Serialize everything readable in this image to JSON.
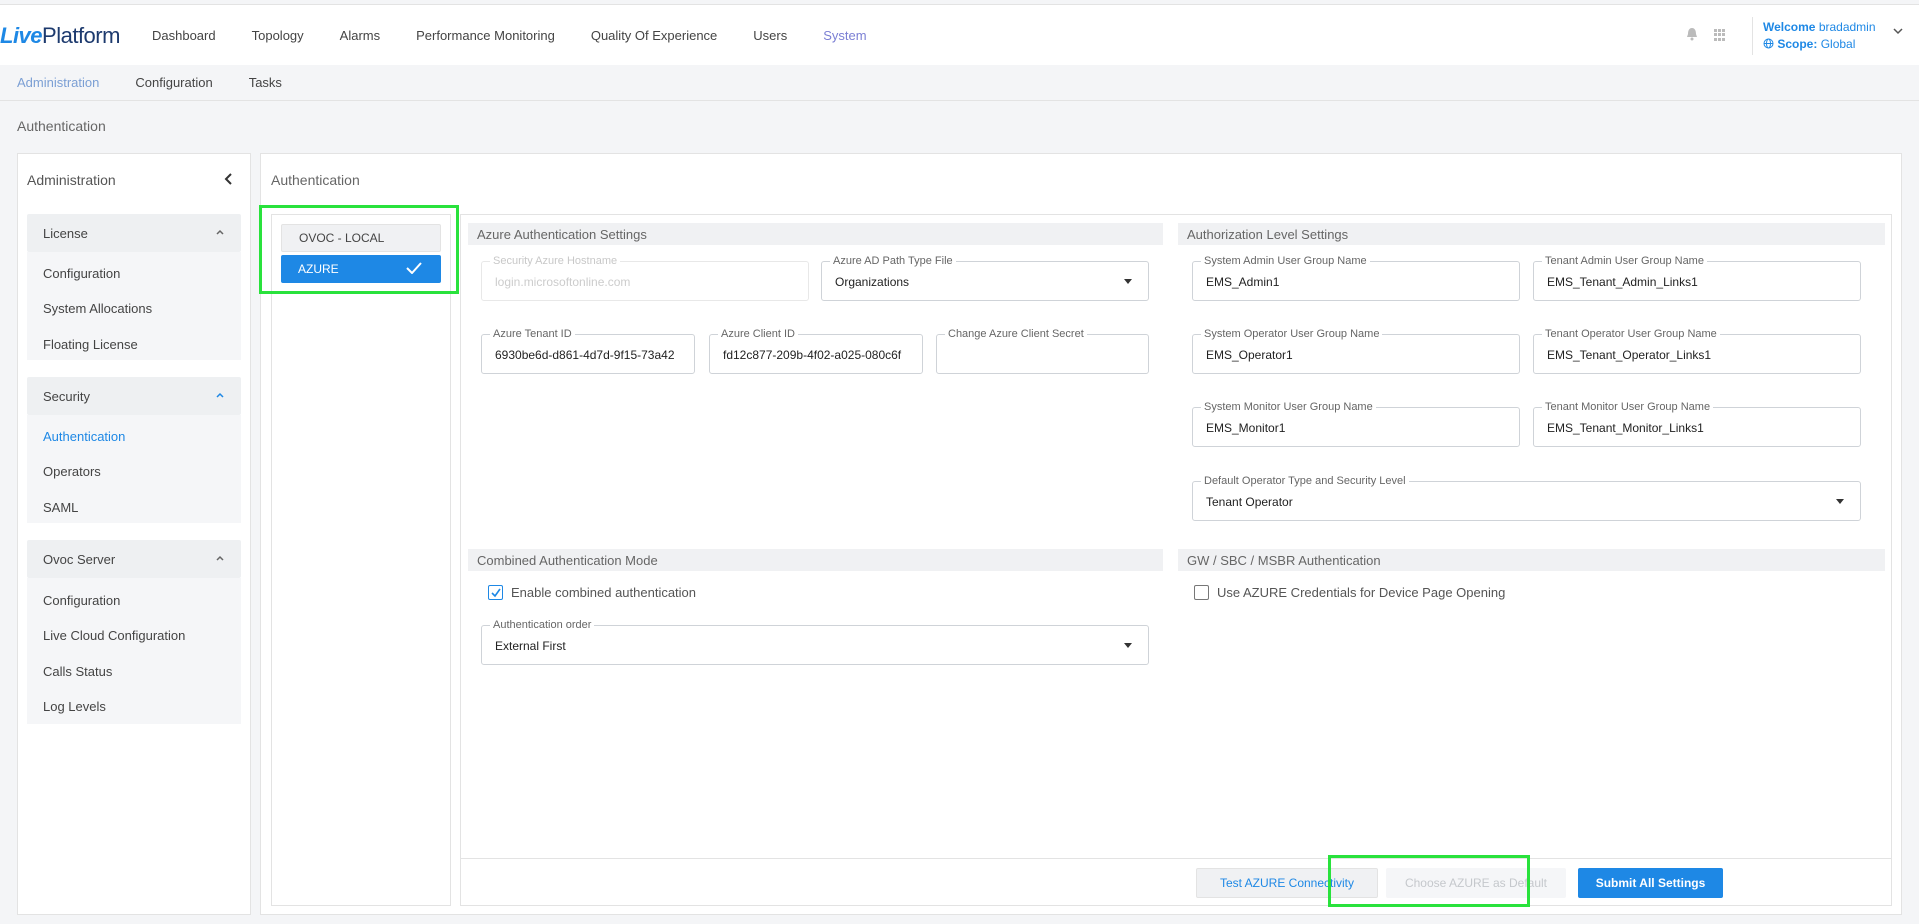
{
  "brand": {
    "logo_prefix": "Live",
    "logo_suffix": "Platform"
  },
  "nav": {
    "items": [
      "Dashboard",
      "Topology",
      "Alarms",
      "Performance Monitoring",
      "Quality Of Experience",
      "Users",
      "System"
    ],
    "active": "System"
  },
  "user": {
    "welcome_label": "Welcome",
    "username": "bradadmin",
    "scope_label": "Scope:",
    "scope_value": "Global"
  },
  "subnav": {
    "items": [
      "Administration",
      "Configuration",
      "Tasks"
    ],
    "active": "Administration"
  },
  "page_title": "Authentication",
  "sidebar": {
    "title": "Administration",
    "groups": [
      {
        "label": "License",
        "items": [
          "Configuration",
          "System Allocations",
          "Floating License"
        ]
      },
      {
        "label": "Security",
        "items": [
          "Authentication",
          "Operators",
          "SAML"
        ]
      },
      {
        "label": "Ovoc Server",
        "items": [
          "Configuration",
          "Live Cloud Configuration",
          "Calls Status",
          "Log Levels"
        ]
      }
    ],
    "active_item": "Authentication"
  },
  "main": {
    "title": "Authentication",
    "methods": {
      "local": "OVOC - LOCAL",
      "azure": "AZURE",
      "selected": "AZURE"
    },
    "azure_settings": {
      "header": "Azure Authentication Settings",
      "hostname": {
        "label": "Security Azure Hostname",
        "value": "login.microsoftonline.com"
      },
      "path_type": {
        "label": "Azure AD Path Type File",
        "value": "Organizations"
      },
      "tenant_id": {
        "label": "Azure Tenant ID",
        "value": "6930be6d-d861-4d7d-9f15-73a42"
      },
      "client_id": {
        "label": "Azure Client ID",
        "value": "fd12c877-209b-4f02-a025-080c6f"
      },
      "client_secret": {
        "label": "Change Azure Client Secret",
        "value": ""
      }
    },
    "authorization": {
      "header": "Authorization Level Settings",
      "sys_admin": {
        "label": "System Admin User Group Name",
        "value": "EMS_Admin1"
      },
      "tenant_admin": {
        "label": "Tenant Admin User Group Name",
        "value": "EMS_Tenant_Admin_Links1"
      },
      "sys_operator": {
        "label": "System Operator User Group Name",
        "value": "EMS_Operator1"
      },
      "tenant_operator": {
        "label": "Tenant Operator User Group Name",
        "value": "EMS_Tenant_Operator_Links1"
      },
      "sys_monitor": {
        "label": "System Monitor User Group Name",
        "value": "EMS_Monitor1"
      },
      "tenant_monitor": {
        "label": "Tenant Monitor User Group Name",
        "value": "EMS_Tenant_Monitor_Links1"
      },
      "default_type": {
        "label": "Default Operator Type and Security Level",
        "value": "Tenant Operator"
      }
    },
    "combined": {
      "header": "Combined Authentication Mode",
      "enable_label": "Enable combined authentication",
      "enable_checked": true,
      "order": {
        "label": "Authentication order",
        "value": "External First"
      }
    },
    "gw": {
      "header": "GW / SBC / MSBR Authentication",
      "use_creds_label": "Use AZURE Credentials for Device Page Opening",
      "use_creds_checked": false
    },
    "buttons": {
      "test": "Test AZURE Connectivity",
      "default": "Choose AZURE as Default",
      "submit": "Submit All Settings"
    }
  },
  "colors": {
    "accent": "#1e88e5",
    "highlight": "#29e23c",
    "nav_active": "#7b7fd4"
  }
}
